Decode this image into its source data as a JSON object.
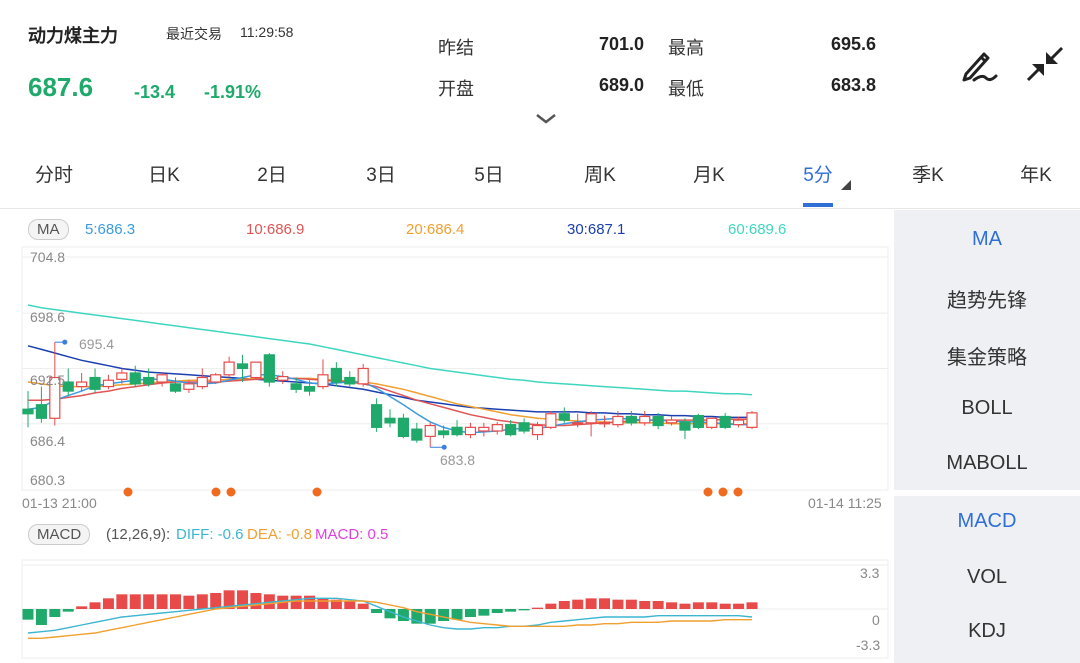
{
  "header": {
    "title": "动力煤主力",
    "trade_label": "最近交易",
    "trade_time": "11:29:58",
    "price": "687.6",
    "change": "-13.4",
    "change_pct": "-1.91%",
    "stats": {
      "prev_settle_label": "昨结",
      "prev_settle": "701.0",
      "high_label": "最高",
      "high": "695.6",
      "open_label": "开盘",
      "open": "689.0",
      "low_label": "最低",
      "low": "683.8"
    },
    "icons": [
      "edit-pen-icon",
      "collapse-icon",
      "chevron-down-icon"
    ]
  },
  "tabs": [
    {
      "label": "分时"
    },
    {
      "label": "日K"
    },
    {
      "label": "2日"
    },
    {
      "label": "3日"
    },
    {
      "label": "5日"
    },
    {
      "label": "周K"
    },
    {
      "label": "月K"
    },
    {
      "label": "5分"
    },
    {
      "label": "季K"
    },
    {
      "label": "年K"
    }
  ],
  "active_tab": "5分",
  "ma_bar": {
    "tag": "MA",
    "ma5": "5:686.3",
    "ma10": "10:686.9",
    "ma20": "20:686.4",
    "ma30": "30:687.1",
    "ma60": "60:689.6"
  },
  "macd_bar": {
    "tag": "MACD",
    "params": "(12,26,9):",
    "diff": "DIFF: -0.6",
    "dea": "DEA: -0.8",
    "macd": "MACD: 0.5"
  },
  "sidebar": {
    "main": [
      "MA",
      "趋势先锋",
      "集金策略",
      "BOLL",
      "MABOLL"
    ],
    "sub": [
      "MACD",
      "VOL",
      "KDJ"
    ]
  },
  "colors": {
    "up": "#e84a4a",
    "down": "#1fa96a",
    "accent": "#2f6fd6",
    "ma5": "#3c9be0",
    "ma10": "#e05555",
    "ma20": "#f0a030",
    "ma30": "#1a3fb0",
    "ma60": "#3fd6c0",
    "diff": "#3cb6d0",
    "dea": "#f0a030",
    "macd": "#e040e0"
  },
  "chart_data": [
    {
      "type": "candlestick",
      "y_ticks": [
        "704.8",
        "698.6",
        "692.5",
        "686.4",
        "680.3"
      ],
      "ylim": [
        680.3,
        704.8
      ],
      "x_labels": [
        "01-13 21:00",
        "01-14 11:25"
      ],
      "annotations": [
        "695.4",
        "683.8"
      ],
      "candles": [
        {
          "o": 688.0,
          "h": 690.0,
          "c": 687.5,
          "l": 686.0
        },
        {
          "o": 688.5,
          "h": 690.5,
          "c": 687.0,
          "l": 686.5
        },
        {
          "o": 687.0,
          "h": 695.4,
          "c": 691.5,
          "l": 686.2
        },
        {
          "o": 691.0,
          "h": 692.5,
          "c": 690.0,
          "l": 689.5
        },
        {
          "o": 690.5,
          "h": 692.0,
          "c": 691.0,
          "l": 690.0
        },
        {
          "o": 691.5,
          "h": 692.5,
          "c": 690.2,
          "l": 689.8
        },
        {
          "o": 690.5,
          "h": 691.8,
          "c": 691.2,
          "l": 690.2
        },
        {
          "o": 691.3,
          "h": 692.5,
          "c": 692.0,
          "l": 690.8
        },
        {
          "o": 692.0,
          "h": 692.8,
          "c": 690.8,
          "l": 690.5
        },
        {
          "o": 691.5,
          "h": 692.5,
          "c": 690.8,
          "l": 690.5
        },
        {
          "o": 691.0,
          "h": 692.0,
          "c": 691.8,
          "l": 690.5
        },
        {
          "o": 690.8,
          "h": 691.5,
          "c": 690.0,
          "l": 689.8
        },
        {
          "o": 690.2,
          "h": 691.2,
          "c": 690.8,
          "l": 689.8
        },
        {
          "o": 690.5,
          "h": 692.5,
          "c": 691.5,
          "l": 690.2
        },
        {
          "o": 691.0,
          "h": 692.0,
          "c": 691.8,
          "l": 690.8
        },
        {
          "o": 691.8,
          "h": 693.8,
          "c": 693.2,
          "l": 691.5
        },
        {
          "o": 693.0,
          "h": 694.0,
          "c": 692.5,
          "l": 691.0
        },
        {
          "o": 691.5,
          "h": 693.0,
          "c": 693.2,
          "l": 691.2
        },
        {
          "o": 694.0,
          "h": 694.2,
          "c": 691.0,
          "l": 690.5
        },
        {
          "o": 691.2,
          "h": 692.2,
          "c": 691.6,
          "l": 690.8
        },
        {
          "o": 690.8,
          "h": 691.5,
          "c": 690.2,
          "l": 689.8
        },
        {
          "o": 690.5,
          "h": 691.2,
          "c": 690.0,
          "l": 689.5
        },
        {
          "o": 690.5,
          "h": 693.5,
          "c": 691.8,
          "l": 690.2
        },
        {
          "o": 692.5,
          "h": 693.2,
          "c": 691.0,
          "l": 690.5
        },
        {
          "o": 691.5,
          "h": 692.2,
          "c": 690.8,
          "l": 690.5
        },
        {
          "o": 690.8,
          "h": 693.0,
          "c": 692.5,
          "l": 690.5
        },
        {
          "o": 688.5,
          "h": 689.2,
          "c": 686.0,
          "l": 685.5
        },
        {
          "o": 687.0,
          "h": 688.0,
          "c": 686.5,
          "l": 686.0
        },
        {
          "o": 687.0,
          "h": 687.5,
          "c": 685.0,
          "l": 684.8
        },
        {
          "o": 685.8,
          "h": 686.5,
          "c": 684.6,
          "l": 684.3
        },
        {
          "o": 685.0,
          "h": 686.5,
          "c": 686.2,
          "l": 683.8
        },
        {
          "o": 685.6,
          "h": 686.2,
          "c": 685.2,
          "l": 684.8
        },
        {
          "o": 686.0,
          "h": 686.8,
          "c": 685.2,
          "l": 685.0
        },
        {
          "o": 685.2,
          "h": 686.5,
          "c": 686.0,
          "l": 684.8
        },
        {
          "o": 685.6,
          "h": 686.5,
          "c": 686.0,
          "l": 685.0
        },
        {
          "o": 685.6,
          "h": 686.6,
          "c": 686.3,
          "l": 685.2
        },
        {
          "o": 686.3,
          "h": 686.8,
          "c": 685.2,
          "l": 685.0
        },
        {
          "o": 686.5,
          "h": 687.0,
          "c": 685.6,
          "l": 685.3
        },
        {
          "o": 685.2,
          "h": 686.6,
          "c": 686.2,
          "l": 684.6
        },
        {
          "o": 686.0,
          "h": 687.8,
          "c": 687.5,
          "l": 685.8
        },
        {
          "o": 687.5,
          "h": 688.2,
          "c": 686.8,
          "l": 686.5
        },
        {
          "o": 686.5,
          "h": 687.5,
          "c": 686.5,
          "l": 686.0
        },
        {
          "o": 686.5,
          "h": 687.8,
          "c": 687.5,
          "l": 685.0
        },
        {
          "o": 686.5,
          "h": 687.3,
          "c": 686.5,
          "l": 686.0
        },
        {
          "o": 686.3,
          "h": 687.8,
          "c": 687.2,
          "l": 686.0
        },
        {
          "o": 687.2,
          "h": 687.8,
          "c": 686.5,
          "l": 686.2
        },
        {
          "o": 686.5,
          "h": 687.8,
          "c": 687.2,
          "l": 686.2
        },
        {
          "o": 687.2,
          "h": 687.6,
          "c": 686.2,
          "l": 685.8
        },
        {
          "o": 686.5,
          "h": 687.2,
          "c": 686.8,
          "l": 686.2
        },
        {
          "o": 686.6,
          "h": 687.0,
          "c": 685.7,
          "l": 684.7
        },
        {
          "o": 687.3,
          "h": 687.5,
          "c": 686.0,
          "l": 685.8
        },
        {
          "o": 686.0,
          "h": 687.0,
          "c": 687.0,
          "l": 685.8
        },
        {
          "o": 687.2,
          "h": 687.6,
          "c": 686.0,
          "l": 685.8
        },
        {
          "o": 686.3,
          "h": 687.2,
          "c": 686.8,
          "l": 686.0
        },
        {
          "o": 686.0,
          "h": 687.8,
          "c": 687.6,
          "l": 685.8
        }
      ],
      "ma_lines": {
        "ma5": [
          688.0,
          688.2,
          689.0,
          689.5,
          690.0,
          690.6,
          690.8,
          691.0,
          691.2,
          691.3,
          691.3,
          691.1,
          690.9,
          690.8,
          690.9,
          691.2,
          691.5,
          691.8,
          691.8,
          691.6,
          691.3,
          690.9,
          690.8,
          690.9,
          691.0,
          691.0,
          690.3,
          689.4,
          688.5,
          687.5,
          686.6,
          686.0,
          685.6,
          685.4,
          685.5,
          685.6,
          685.8,
          685.9,
          685.9,
          686.1,
          686.4,
          686.6,
          686.8,
          686.9,
          687.0,
          686.9,
          686.8,
          686.8,
          686.7,
          686.6,
          686.6,
          686.5,
          686.4,
          686.3,
          686.3
        ],
        "ma10": [
          689.0,
          689.0,
          689.1,
          689.3,
          689.5,
          689.8,
          690.0,
          690.3,
          690.5,
          690.7,
          690.9,
          691.0,
          691.0,
          691.0,
          691.0,
          691.1,
          691.2,
          691.3,
          691.4,
          691.4,
          691.4,
          691.3,
          691.2,
          691.1,
          691.0,
          690.8,
          690.5,
          690.0,
          689.5,
          689.0,
          688.6,
          688.2,
          687.8,
          687.4,
          687.1,
          686.8,
          686.6,
          686.4,
          686.3,
          686.2,
          686.2,
          686.3,
          686.4,
          686.5,
          686.6,
          686.7,
          686.8,
          686.8,
          686.8,
          686.8,
          686.8,
          686.8,
          686.9,
          686.9,
          686.9
        ],
        "ma20": [
          691.0,
          690.8,
          690.6,
          690.5,
          690.5,
          690.5,
          690.6,
          690.7,
          690.8,
          690.9,
          691.0,
          691.1,
          691.2,
          691.2,
          691.2,
          691.3,
          691.3,
          691.4,
          691.4,
          691.4,
          691.4,
          691.4,
          691.3,
          691.2,
          691.1,
          691.0,
          690.8,
          690.5,
          690.2,
          689.8,
          689.4,
          689.0,
          688.6,
          688.3,
          688.0,
          687.7,
          687.4,
          687.2,
          687.0,
          686.9,
          686.8,
          686.7,
          686.6,
          686.6,
          686.5,
          686.5,
          686.5,
          686.5,
          686.4,
          686.4,
          686.4,
          686.4,
          686.4,
          686.4,
          686.4
        ],
        "ma30": [
          695.0,
          694.6,
          694.2,
          693.8,
          693.4,
          693.1,
          692.8,
          692.5,
          692.3,
          692.1,
          692.0,
          691.9,
          691.8,
          691.7,
          691.6,
          691.5,
          691.4,
          691.3,
          691.2,
          691.1,
          691.0,
          690.9,
          690.8,
          690.6,
          690.4,
          690.2,
          689.9,
          689.6,
          689.3,
          689.0,
          688.8,
          688.6,
          688.4,
          688.2,
          688.1,
          688.0,
          687.9,
          687.8,
          687.7,
          687.7,
          687.7,
          687.7,
          687.6,
          687.6,
          687.5,
          687.5,
          687.4,
          687.4,
          687.3,
          687.3,
          687.2,
          687.2,
          687.1,
          687.1,
          687.1
        ],
        "ma60": [
          699.5,
          699.2,
          699.0,
          698.8,
          698.6,
          698.4,
          698.2,
          698.0,
          697.8,
          697.6,
          697.4,
          697.2,
          697.0,
          696.8,
          696.6,
          696.4,
          696.2,
          696.0,
          695.8,
          695.6,
          695.4,
          695.2,
          694.9,
          694.6,
          694.3,
          694.0,
          693.7,
          693.4,
          693.1,
          692.8,
          692.5,
          692.3,
          692.1,
          691.9,
          691.7,
          691.5,
          691.3,
          691.2,
          691.0,
          690.9,
          690.8,
          690.7,
          690.6,
          690.5,
          690.4,
          690.3,
          690.2,
          690.1,
          690.0,
          690.0,
          689.9,
          689.8,
          689.7,
          689.7,
          689.6
        ]
      }
    },
    {
      "type": "bar",
      "name": "MACD",
      "y_ticks": [
        "3.3",
        "0",
        "-3.3"
      ],
      "ylim": [
        -3.3,
        3.3
      ],
      "values": [
        -0.8,
        -1.2,
        -0.6,
        -0.2,
        0.2,
        0.5,
        0.8,
        1.1,
        1.1,
        1.1,
        1.1,
        1.1,
        1.0,
        1.1,
        1.2,
        1.4,
        1.4,
        1.2,
        1.1,
        1.0,
        1.0,
        1.0,
        0.8,
        0.7,
        0.6,
        0.4,
        -0.3,
        -0.7,
        -0.9,
        -1.1,
        -1.1,
        -0.9,
        -0.8,
        -0.6,
        -0.5,
        -0.3,
        -0.2,
        -0.1,
        0.1,
        0.4,
        0.6,
        0.7,
        0.8,
        0.8,
        0.7,
        0.7,
        0.6,
        0.6,
        0.5,
        0.4,
        0.5,
        0.5,
        0.4,
        0.4,
        0.5
      ],
      "diff": [
        -1.8,
        -1.7,
        -1.6,
        -1.4,
        -1.2,
        -1.0,
        -0.8,
        -0.6,
        -0.5,
        -0.4,
        -0.3,
        -0.2,
        -0.1,
        0.0,
        0.1,
        0.2,
        0.3,
        0.4,
        0.5,
        0.6,
        0.7,
        0.8,
        0.8,
        0.8,
        0.7,
        0.6,
        0.2,
        -0.2,
        -0.6,
        -0.9,
        -1.2,
        -1.4,
        -1.5,
        -1.5,
        -1.4,
        -1.4,
        -1.3,
        -1.3,
        -1.2,
        -1.0,
        -0.9,
        -0.8,
        -0.7,
        -0.6,
        -0.6,
        -0.6,
        -0.6,
        -0.5,
        -0.5,
        -0.5,
        -0.5,
        -0.5,
        -0.5,
        -0.5,
        -0.6
      ],
      "dea": [
        -2.2,
        -2.2,
        -2.1,
        -2.0,
        -1.9,
        -1.8,
        -1.6,
        -1.4,
        -1.2,
        -1.0,
        -0.8,
        -0.6,
        -0.4,
        -0.2,
        0.0,
        0.1,
        0.2,
        0.3,
        0.4,
        0.5,
        0.6,
        0.6,
        0.6,
        0.6,
        0.6,
        0.6,
        0.5,
        0.3,
        0.1,
        -0.2,
        -0.4,
        -0.6,
        -0.8,
        -1.0,
        -1.1,
        -1.2,
        -1.3,
        -1.3,
        -1.3,
        -1.3,
        -1.3,
        -1.2,
        -1.2,
        -1.1,
        -1.1,
        -1.0,
        -1.0,
        -1.0,
        -0.9,
        -0.9,
        -0.9,
        -0.9,
        -0.8,
        -0.8,
        -0.8
      ]
    }
  ]
}
